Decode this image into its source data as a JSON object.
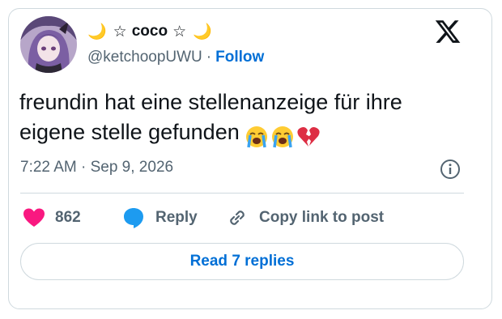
{
  "author": {
    "name_left_deco": "🌙",
    "name_star_left": "☆",
    "display_name": "coco",
    "name_star_right": "☆",
    "name_right_deco": "🌙",
    "handle": "@ketchoopUWU",
    "separator": "·",
    "follow_label": "Follow"
  },
  "tweet": {
    "text_line1": "freundin hat eine stellenanzeige für ihre",
    "text_line2": "eigene stelle gefunden",
    "emojis": [
      "loudly-crying-face",
      "loudly-crying-face",
      "broken-heart"
    ],
    "timestamp": "7:22 AM · Sep 9, 2026"
  },
  "actions": {
    "like_count": "862",
    "reply_label": "Reply",
    "copy_label": "Copy link to post"
  },
  "footer": {
    "read_replies_label": "Read 7 replies"
  },
  "colors": {
    "accent": "#006fd6",
    "like": "#f91880",
    "reply_bubble": "#1d9bf0",
    "secondary_text": "#536471",
    "border": "#cfd9de"
  }
}
